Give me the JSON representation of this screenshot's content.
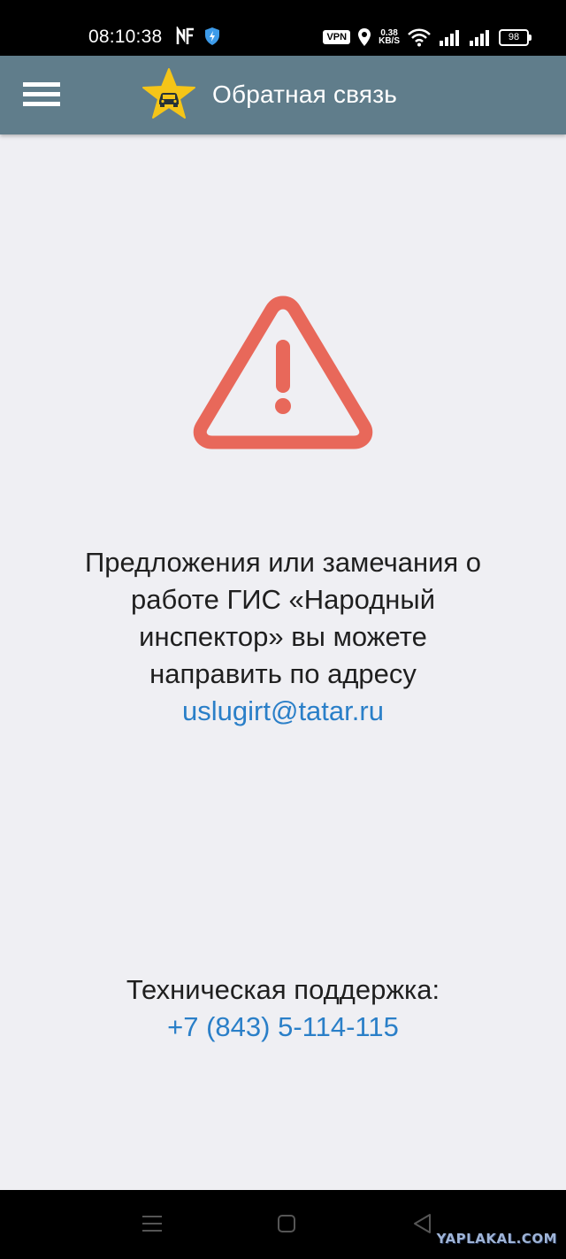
{
  "status_bar": {
    "time": "08:10:38",
    "vpn_label": "VPN",
    "net_speed_value": "0.38",
    "net_speed_unit": "KB/S",
    "battery_level": "98"
  },
  "app_bar": {
    "title": "Обратная связь",
    "menu_icon": "hamburger-menu-icon",
    "logo_icon": "star-car-logo"
  },
  "content": {
    "warning_icon": "warning-triangle-icon",
    "warning_color": "#e8685a",
    "message_line1": "Предложения или замечания о",
    "message_line2": "работе ГИС «Народный",
    "message_line3": "инспектор» вы можете",
    "message_line4": "направить по адресу",
    "email": "uslugirt@tatar.ru",
    "support_label": "Техническая поддержка:",
    "phone": "+7 (843) 5-114-115",
    "link_color": "#2a7fc8"
  },
  "nav_bar": {
    "recents_icon": "recents-icon",
    "home_icon": "home-icon",
    "back_icon": "back-icon"
  },
  "watermark": "YAPLAKAL.COM"
}
